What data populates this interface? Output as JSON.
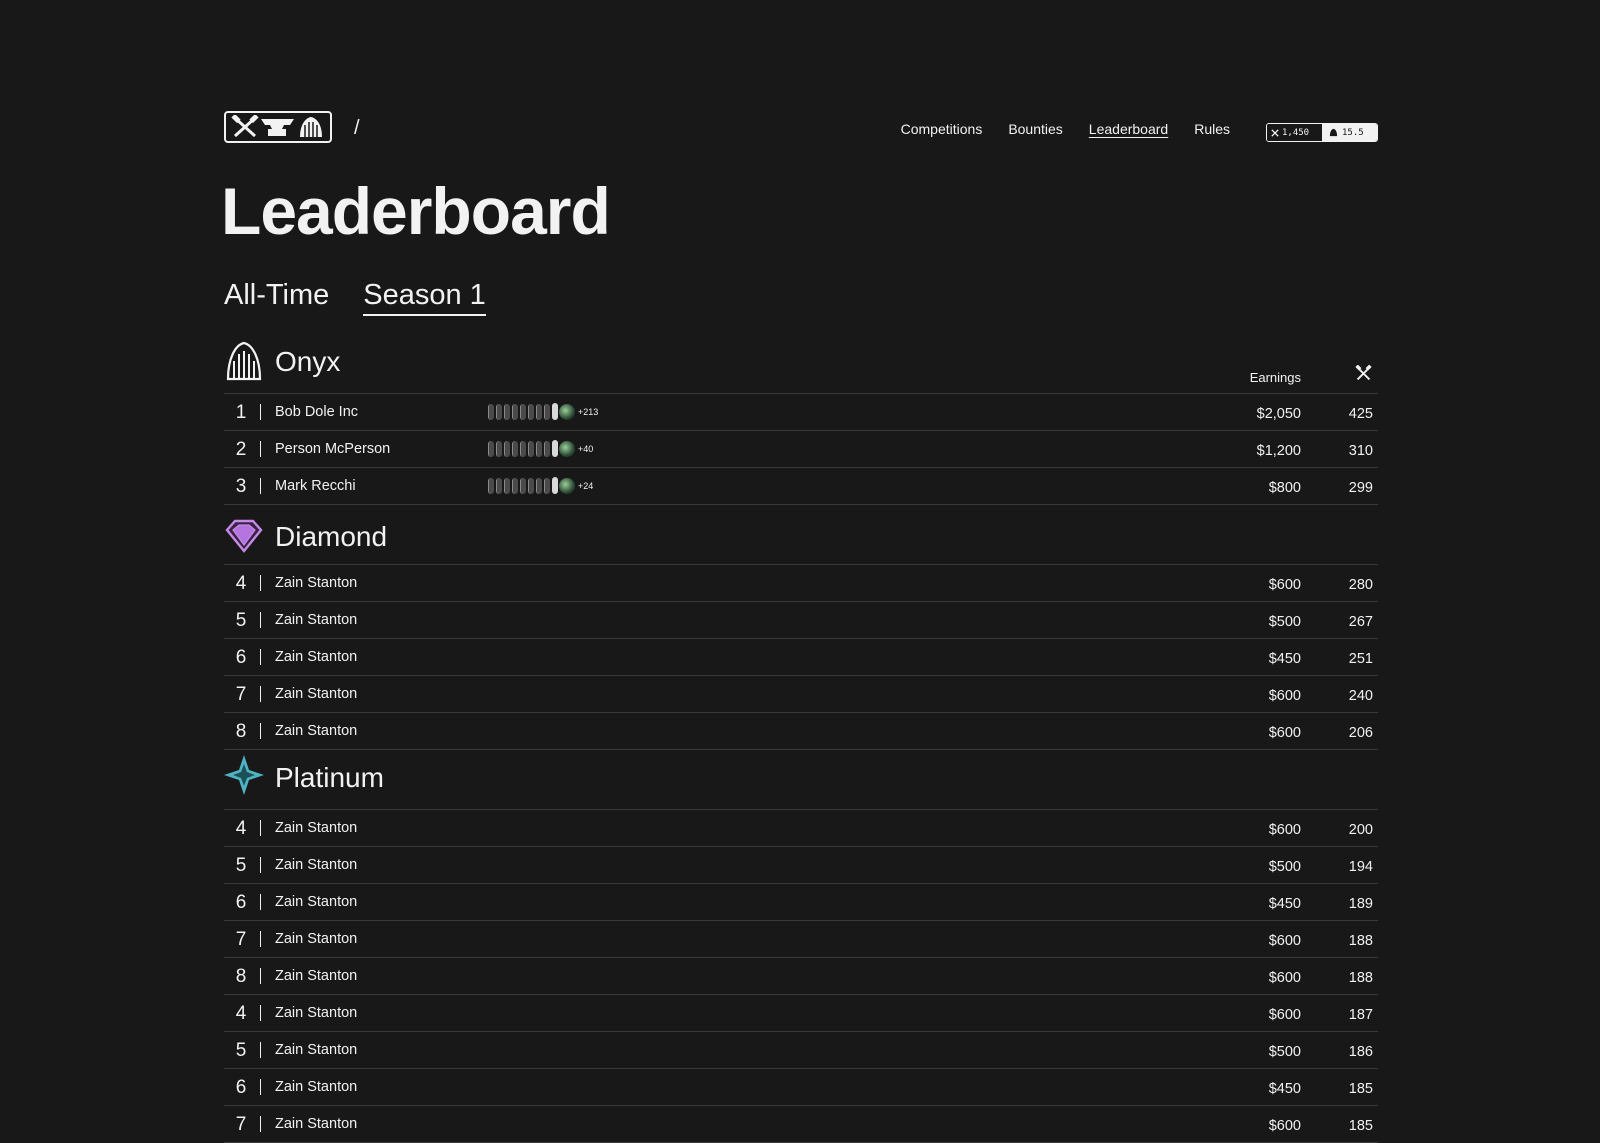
{
  "header": {
    "slash": "/",
    "nav": [
      "Competitions",
      "Bounties",
      "Leaderboard",
      "Rules"
    ],
    "active_nav": "Leaderboard",
    "wallet": {
      "hammers": "1,450",
      "tokens": "15.5"
    }
  },
  "title": "Leaderboard",
  "tabs": [
    {
      "label": "All-Time",
      "active": false
    },
    {
      "label": "Season 1",
      "active": true
    }
  ],
  "columns": {
    "earnings": "Earnings",
    "points_icon": "hammers-icon"
  },
  "tiers": [
    {
      "name": "Onyx",
      "icon": "onyx-wing-icon",
      "color": "#f2f2f2",
      "rows": [
        {
          "rank": "1",
          "name": "Bob Dole Inc",
          "streak": "+213",
          "earnings": "$2,050",
          "points": "425"
        },
        {
          "rank": "2",
          "name": "Person McPerson",
          "streak": "+40",
          "earnings": "$1,200",
          "points": "310"
        },
        {
          "rank": "3",
          "name": "Mark Recchi",
          "streak": "+24",
          "earnings": "$800",
          "points": "299"
        }
      ]
    },
    {
      "name": "Diamond",
      "icon": "diamond-gem-icon",
      "color": "#c58be6",
      "rows": [
        {
          "rank": "4",
          "name": "Zain Stanton",
          "earnings": "$600",
          "points": "280"
        },
        {
          "rank": "5",
          "name": "Zain Stanton",
          "earnings": "$500",
          "points": "267"
        },
        {
          "rank": "6",
          "name": "Zain Stanton",
          "earnings": "$450",
          "points": "251"
        },
        {
          "rank": "7",
          "name": "Zain Stanton",
          "earnings": "$600",
          "points": "240"
        },
        {
          "rank": "8",
          "name": "Zain Stanton",
          "earnings": "$600",
          "points": "206"
        }
      ]
    },
    {
      "name": "Platinum",
      "icon": "platinum-star-icon",
      "color": "#4fb3c4",
      "rows": [
        {
          "rank": "4",
          "name": "Zain Stanton",
          "earnings": "$600",
          "points": "200"
        },
        {
          "rank": "5",
          "name": "Zain Stanton",
          "earnings": "$500",
          "points": "194"
        },
        {
          "rank": "6",
          "name": "Zain Stanton",
          "earnings": "$450",
          "points": "189"
        },
        {
          "rank": "7",
          "name": "Zain Stanton",
          "earnings": "$600",
          "points": "188"
        },
        {
          "rank": "8",
          "name": "Zain Stanton",
          "earnings": "$600",
          "points": "188"
        },
        {
          "rank": "4",
          "name": "Zain Stanton",
          "earnings": "$600",
          "points": "187"
        },
        {
          "rank": "5",
          "name": "Zain Stanton",
          "earnings": "$500",
          "points": "186"
        },
        {
          "rank": "6",
          "name": "Zain Stanton",
          "earnings": "$450",
          "points": "185"
        },
        {
          "rank": "7",
          "name": "Zain Stanton",
          "earnings": "$600",
          "points": "185"
        }
      ]
    }
  ]
}
